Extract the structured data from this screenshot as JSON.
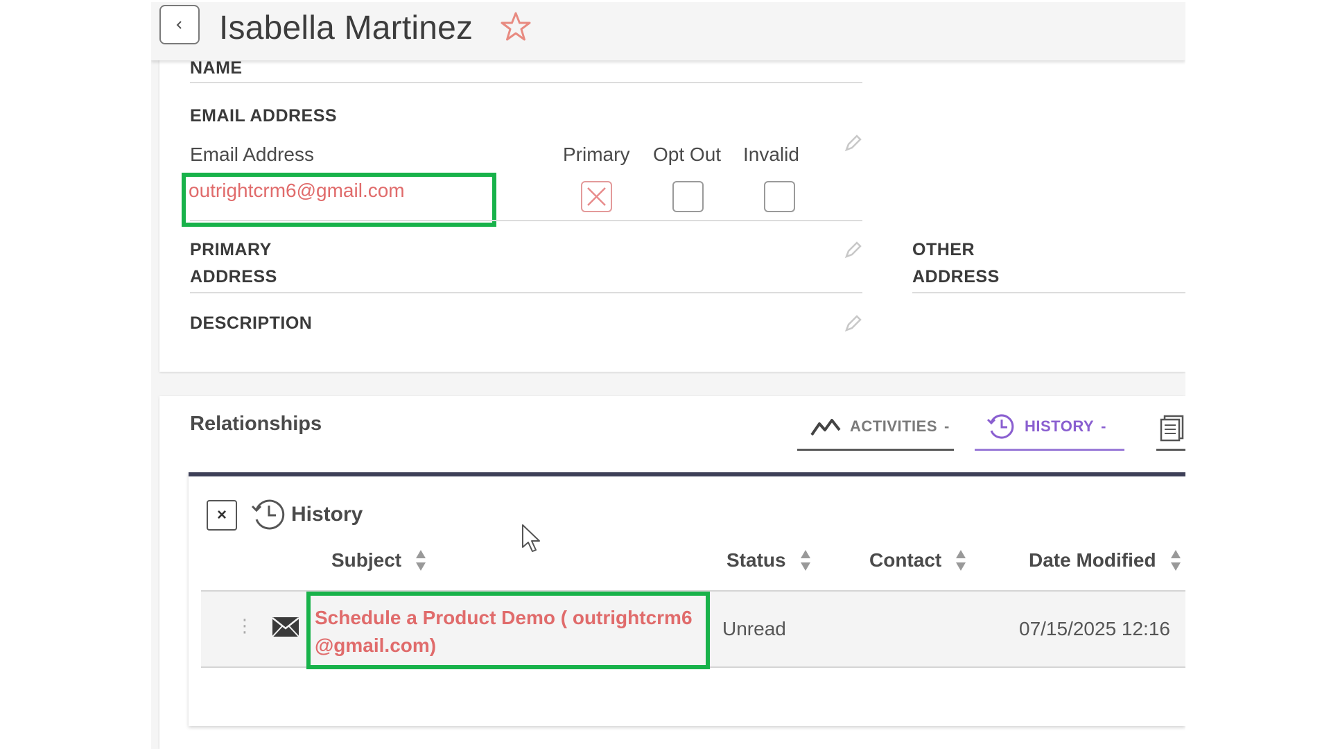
{
  "header": {
    "back_label": "<",
    "title": "Isabella Martinez"
  },
  "detail": {
    "name_label": "NAME",
    "email_section_label": "EMAIL ADDRESS",
    "email_column_label": "Email Address",
    "primary_label": "Primary",
    "opt_out_label": "Opt Out",
    "invalid_label": "Invalid",
    "email_value": "outrightcrm6@gmail.com",
    "primary_checked": true,
    "opt_out_checked": false,
    "invalid_checked": false,
    "primary_address_label_1": "PRIMARY",
    "primary_address_label_2": "ADDRESS",
    "other_address_label_1": "OTHER",
    "other_address_label_2": "ADDRESS",
    "description_label": "DESCRIPTION"
  },
  "relationships": {
    "title": "Relationships",
    "tabs": [
      {
        "label": "ACTIVITIES",
        "suffix": "-"
      },
      {
        "label": "HISTORY",
        "suffix": "-"
      }
    ],
    "history": {
      "close_label": "×",
      "title": "History",
      "columns": [
        "Subject",
        "Status",
        "Contact",
        "Date Modified"
      ],
      "rows": [
        {
          "menu": "⋮",
          "subject": "Schedule a Product Demo ( outrightcrm6 @gmail.com)",
          "status": "Unread",
          "contact": "",
          "date_modified": "07/15/2025 12:16"
        }
      ]
    }
  },
  "colors": {
    "link": "#e06b6b",
    "highlight": "#18b24a",
    "accent": "#8a5fd0"
  }
}
